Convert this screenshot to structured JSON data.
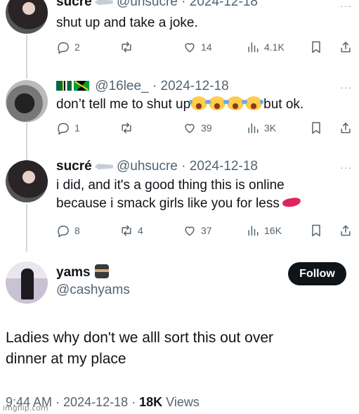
{
  "tweets": [
    {
      "name": "sucre",
      "handle": "@uhsucre",
      "date": "2024-12-18",
      "text_lines": [
        "shut up and take a joke."
      ],
      "replies": "2",
      "reposts": "",
      "likes": "14",
      "views": "4.1K"
    },
    {
      "name": "",
      "handle": "@16lee_",
      "date": "2024-12-18",
      "text_lines": [
        "don’t tell me to shut up",
        "but ok."
      ],
      "replies": "1",
      "reposts": "",
      "likes": "39",
      "views": "3K"
    },
    {
      "name": "sucré",
      "handle": "@uhsucre",
      "date": "2024-12-18",
      "text_lines": [
        "i did, and it's a good thing this is online",
        "because i smack girls like you for less"
      ],
      "replies": "8",
      "reposts": "4",
      "likes": "37",
      "views": "16K"
    }
  ],
  "main": {
    "name": "yams",
    "handle": "@cashyams",
    "follow_label": "Follow",
    "text_lines": [
      "Ladies why don't we alll sort this out over",
      "dinner at my place"
    ],
    "time": "9:44 AM",
    "date": "2024-12-18",
    "views_count": "18K",
    "views_label": "Views"
  },
  "separator": " · ",
  "more_glyph": "···",
  "watermark": "imgflip.com",
  "icons": [
    "reply-icon",
    "repost-icon",
    "like-icon",
    "views-icon",
    "bookmark-icon",
    "share-icon"
  ],
  "colors": {
    "text": "#0f1419",
    "secondary": "#536471",
    "line": "#cfd9de",
    "button": "#0f1419"
  }
}
